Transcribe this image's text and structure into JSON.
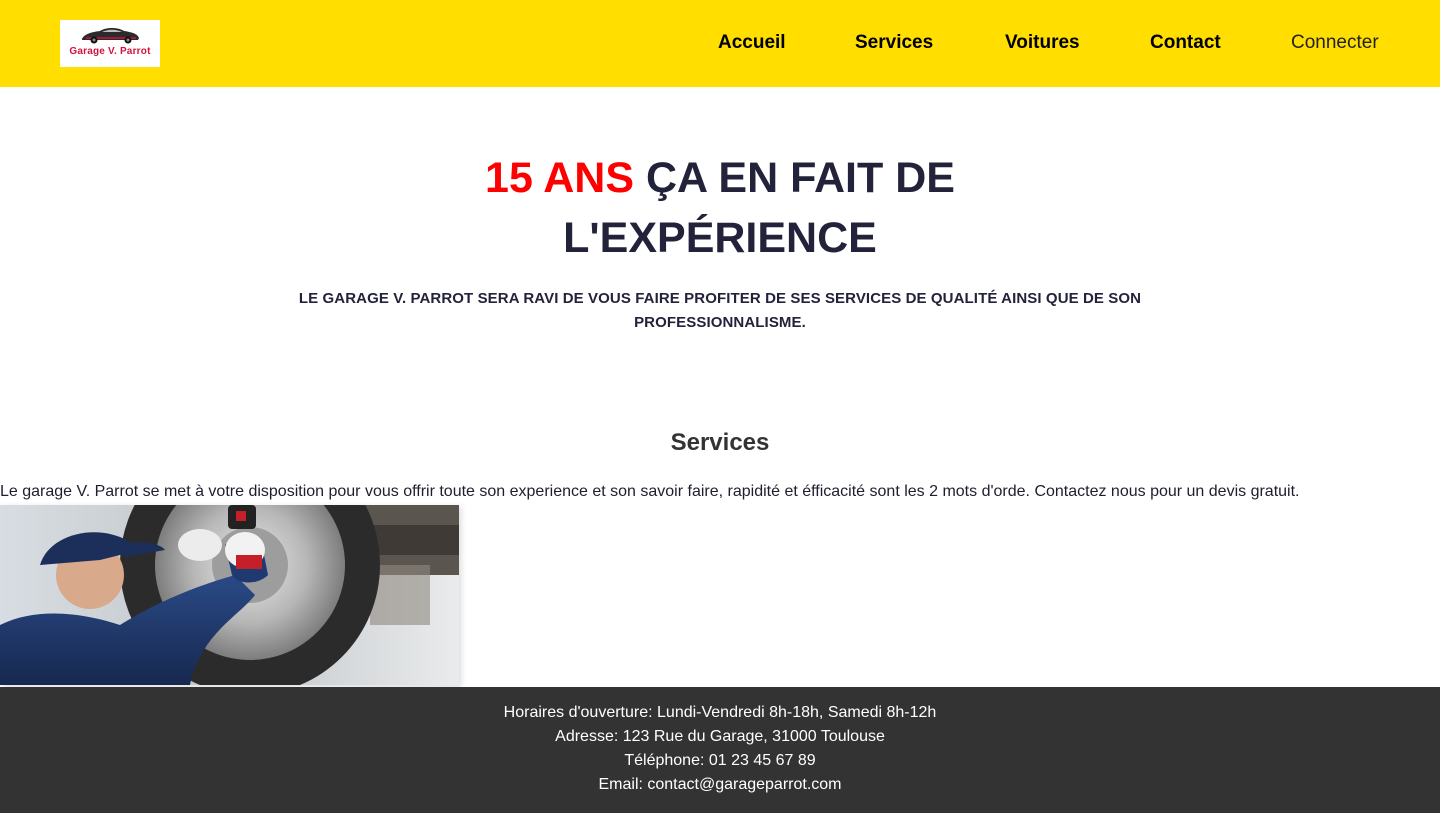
{
  "brand": {
    "logo_text": "Garage V. Parrot",
    "header_color": "#ffde00",
    "accent_color": "#ff0000",
    "logo_text_color": "#d0133c"
  },
  "nav": {
    "items": [
      {
        "label": "Accueil"
      },
      {
        "label": "Services"
      },
      {
        "label": "Voitures"
      },
      {
        "label": "Contact"
      }
    ],
    "connect_label": "Connecter"
  },
  "hero": {
    "accent": "15 ANS",
    "title_line1_rest": "ÇA EN FAIT DE",
    "title_line2": "L'EXPÉRIENCE",
    "subtitle": "LE GARAGE V. PARROT SERA RAVI DE VOUS FAIRE PROFITER DE SES SERVICES DE QUALITÉ AINSI QUE DE SON PROFESSIONNALISME."
  },
  "services": {
    "heading": "Services",
    "text": "Le garage V. Parrot se met à votre disposition pour vous offrir toute son experience et son savoir faire, rapidité et éfficacité sont les 2 mots d'orde. Contactez nous pour un devis gratuit."
  },
  "footer": {
    "hours": "Horaires d'ouverture: Lundi-Vendredi 8h-18h, Samedi 8h-12h",
    "address": "Adresse: 123 Rue du Garage, 31000 Toulouse",
    "phone": "Téléphone: 01 23 45 67 89",
    "email": "Email: contact@garageparrot.com",
    "background": "#333333"
  }
}
